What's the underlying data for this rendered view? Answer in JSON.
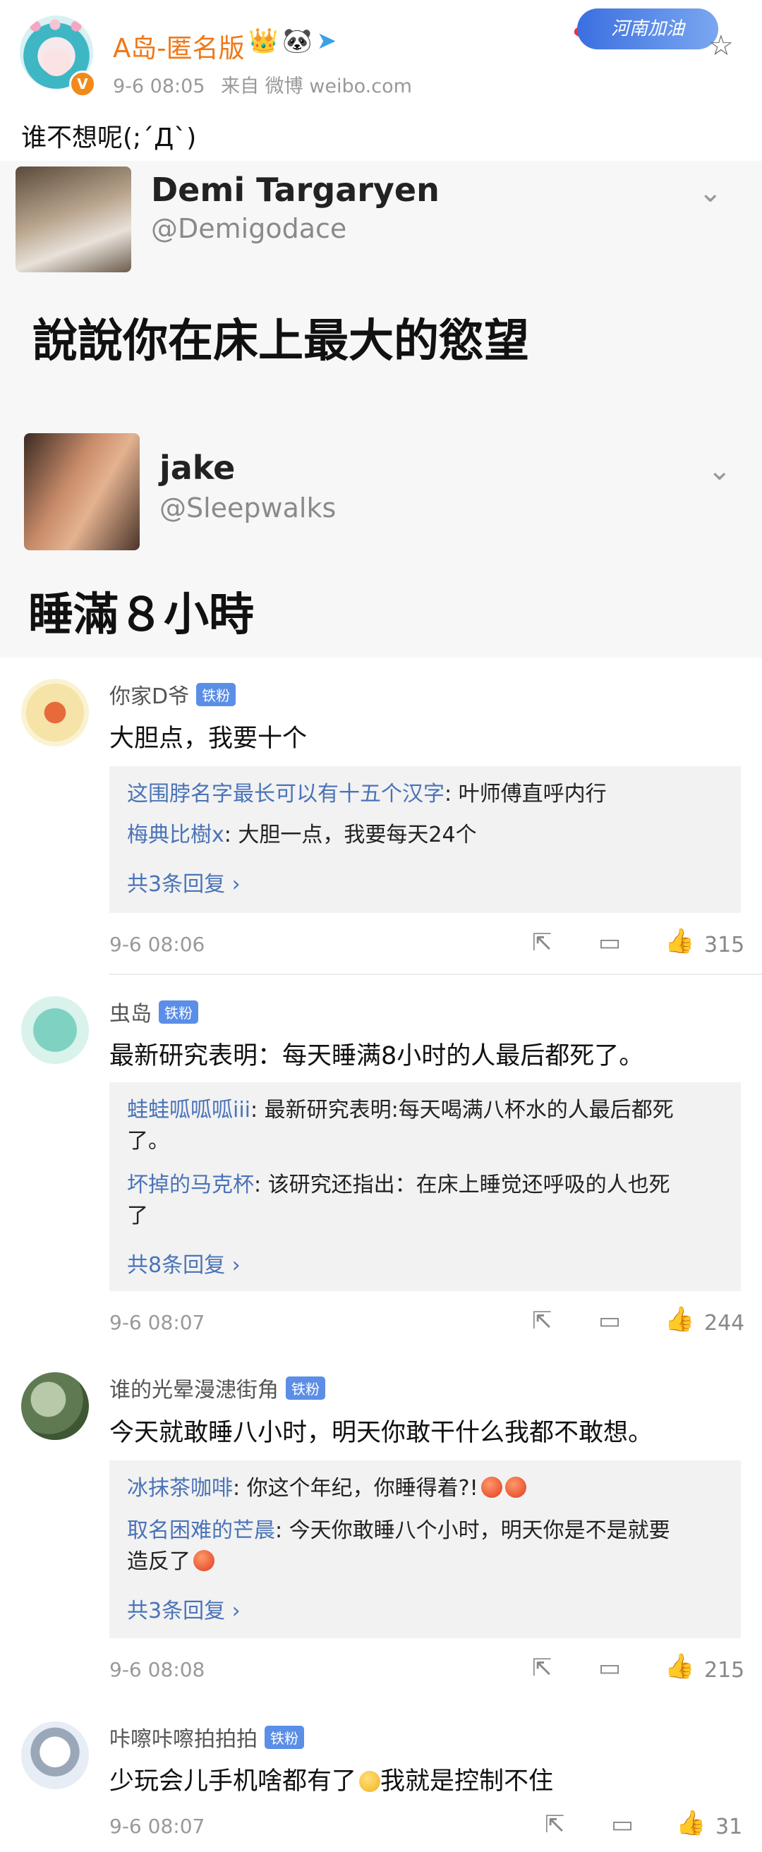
{
  "post": {
    "author": "A岛-匿名版",
    "verified_badge": "V",
    "author_icons": "👑🐼",
    "time": "9-6 08:05",
    "source": "来自 微博 weibo.com",
    "badge_text": "河南加油",
    "text": "谁不想呢(;´Д`)"
  },
  "embed": {
    "tweet1": {
      "name": "Demi Targaryen",
      "handle": "@Demigodace",
      "text": "說說你在床上最大的慾望"
    },
    "tweet2": {
      "name": "jake",
      "handle": "@Sleepwalks",
      "text": "睡滿８小時"
    }
  },
  "comments": [
    {
      "user": "你家D爷",
      "badge": "铁粉",
      "text": "大胆点，我要十个",
      "replies": [
        {
          "user": "这围脖名字最长可以有十五个汉字",
          "text": ": 叶师傅直呼内行"
        },
        {
          "user": "梅典比樹x",
          "text": ": 大胆一点，我要每天24个"
        }
      ],
      "more": "共3条回复 ›",
      "time": "9-6 08:06",
      "likes": "315"
    },
    {
      "user": "虫岛",
      "badge": "铁粉",
      "text": "最新研究表明：每天睡满8小时的人最后都死了。",
      "replies": [
        {
          "user": "蛙蛙呱呱呱iii",
          "text": ": 最新研究表明:每天喝满八杯水的人最后都死",
          "cont": "了。"
        },
        {
          "user": "坏掉的马克杯",
          "text": ": 该研究还指出：在床上睡觉还呼吸的人也死",
          "cont": "了"
        }
      ],
      "more": "共8条回复 ›",
      "time": "9-6 08:07",
      "likes": "244"
    },
    {
      "user": "谁的光晕漫漶街角",
      "badge": "铁粉",
      "text": "今天就敢睡八小时，明天你敢干什么我都不敢想。",
      "replies": [
        {
          "user": "冰抹茶咖啡",
          "text": ": 你这个年纪，你睡得着?!"
        },
        {
          "user": "取名困难的芒晨",
          "text": ": 今天你敢睡八个小时，明天你是不是就要",
          "cont": "造反了"
        }
      ],
      "more": "共3条回复 ›",
      "time": "9-6 08:08",
      "likes": "215"
    },
    {
      "user": "咔嚓咔嚓拍拍拍",
      "badge": "铁粉",
      "text": "少玩会儿手机啥都有了",
      "text2": "我就是控制不住",
      "time": "9-6 08:07",
      "likes": "31"
    }
  ],
  "icons": {
    "share": "⇱",
    "comment": "▭",
    "like": "👍",
    "star": "☆",
    "chevron": "⌄",
    "heart": "❤"
  }
}
